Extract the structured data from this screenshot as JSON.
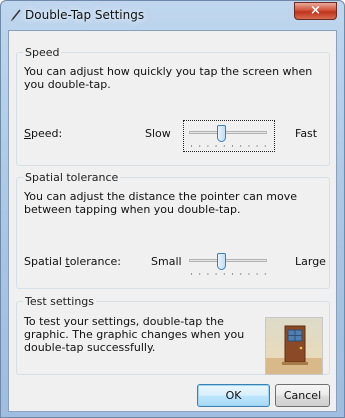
{
  "window": {
    "title": "Double-Tap Settings",
    "close_symbol": "×"
  },
  "speed": {
    "group_title": "Speed",
    "description": "You can adjust how quickly you tap the screen when you double-tap.",
    "label_prefix": "",
    "label_accesskey": "S",
    "label_rest": "peed:",
    "min_label": "Slow",
    "max_label": "Fast",
    "value": 0.4
  },
  "spatial": {
    "group_title": "Spatial tolerance",
    "description": "You can adjust the distance the pointer can move between tapping when you double-tap.",
    "label_prefix": "Spatial ",
    "label_accesskey": "t",
    "label_rest": "olerance:",
    "min_label": "Small",
    "max_label": "Large",
    "value": 0.4
  },
  "test": {
    "group_title": "Test settings",
    "description": "To test your settings, double-tap the graphic. The graphic changes when you double-tap successfully."
  },
  "buttons": {
    "ok": "OK",
    "cancel": "Cancel"
  }
}
